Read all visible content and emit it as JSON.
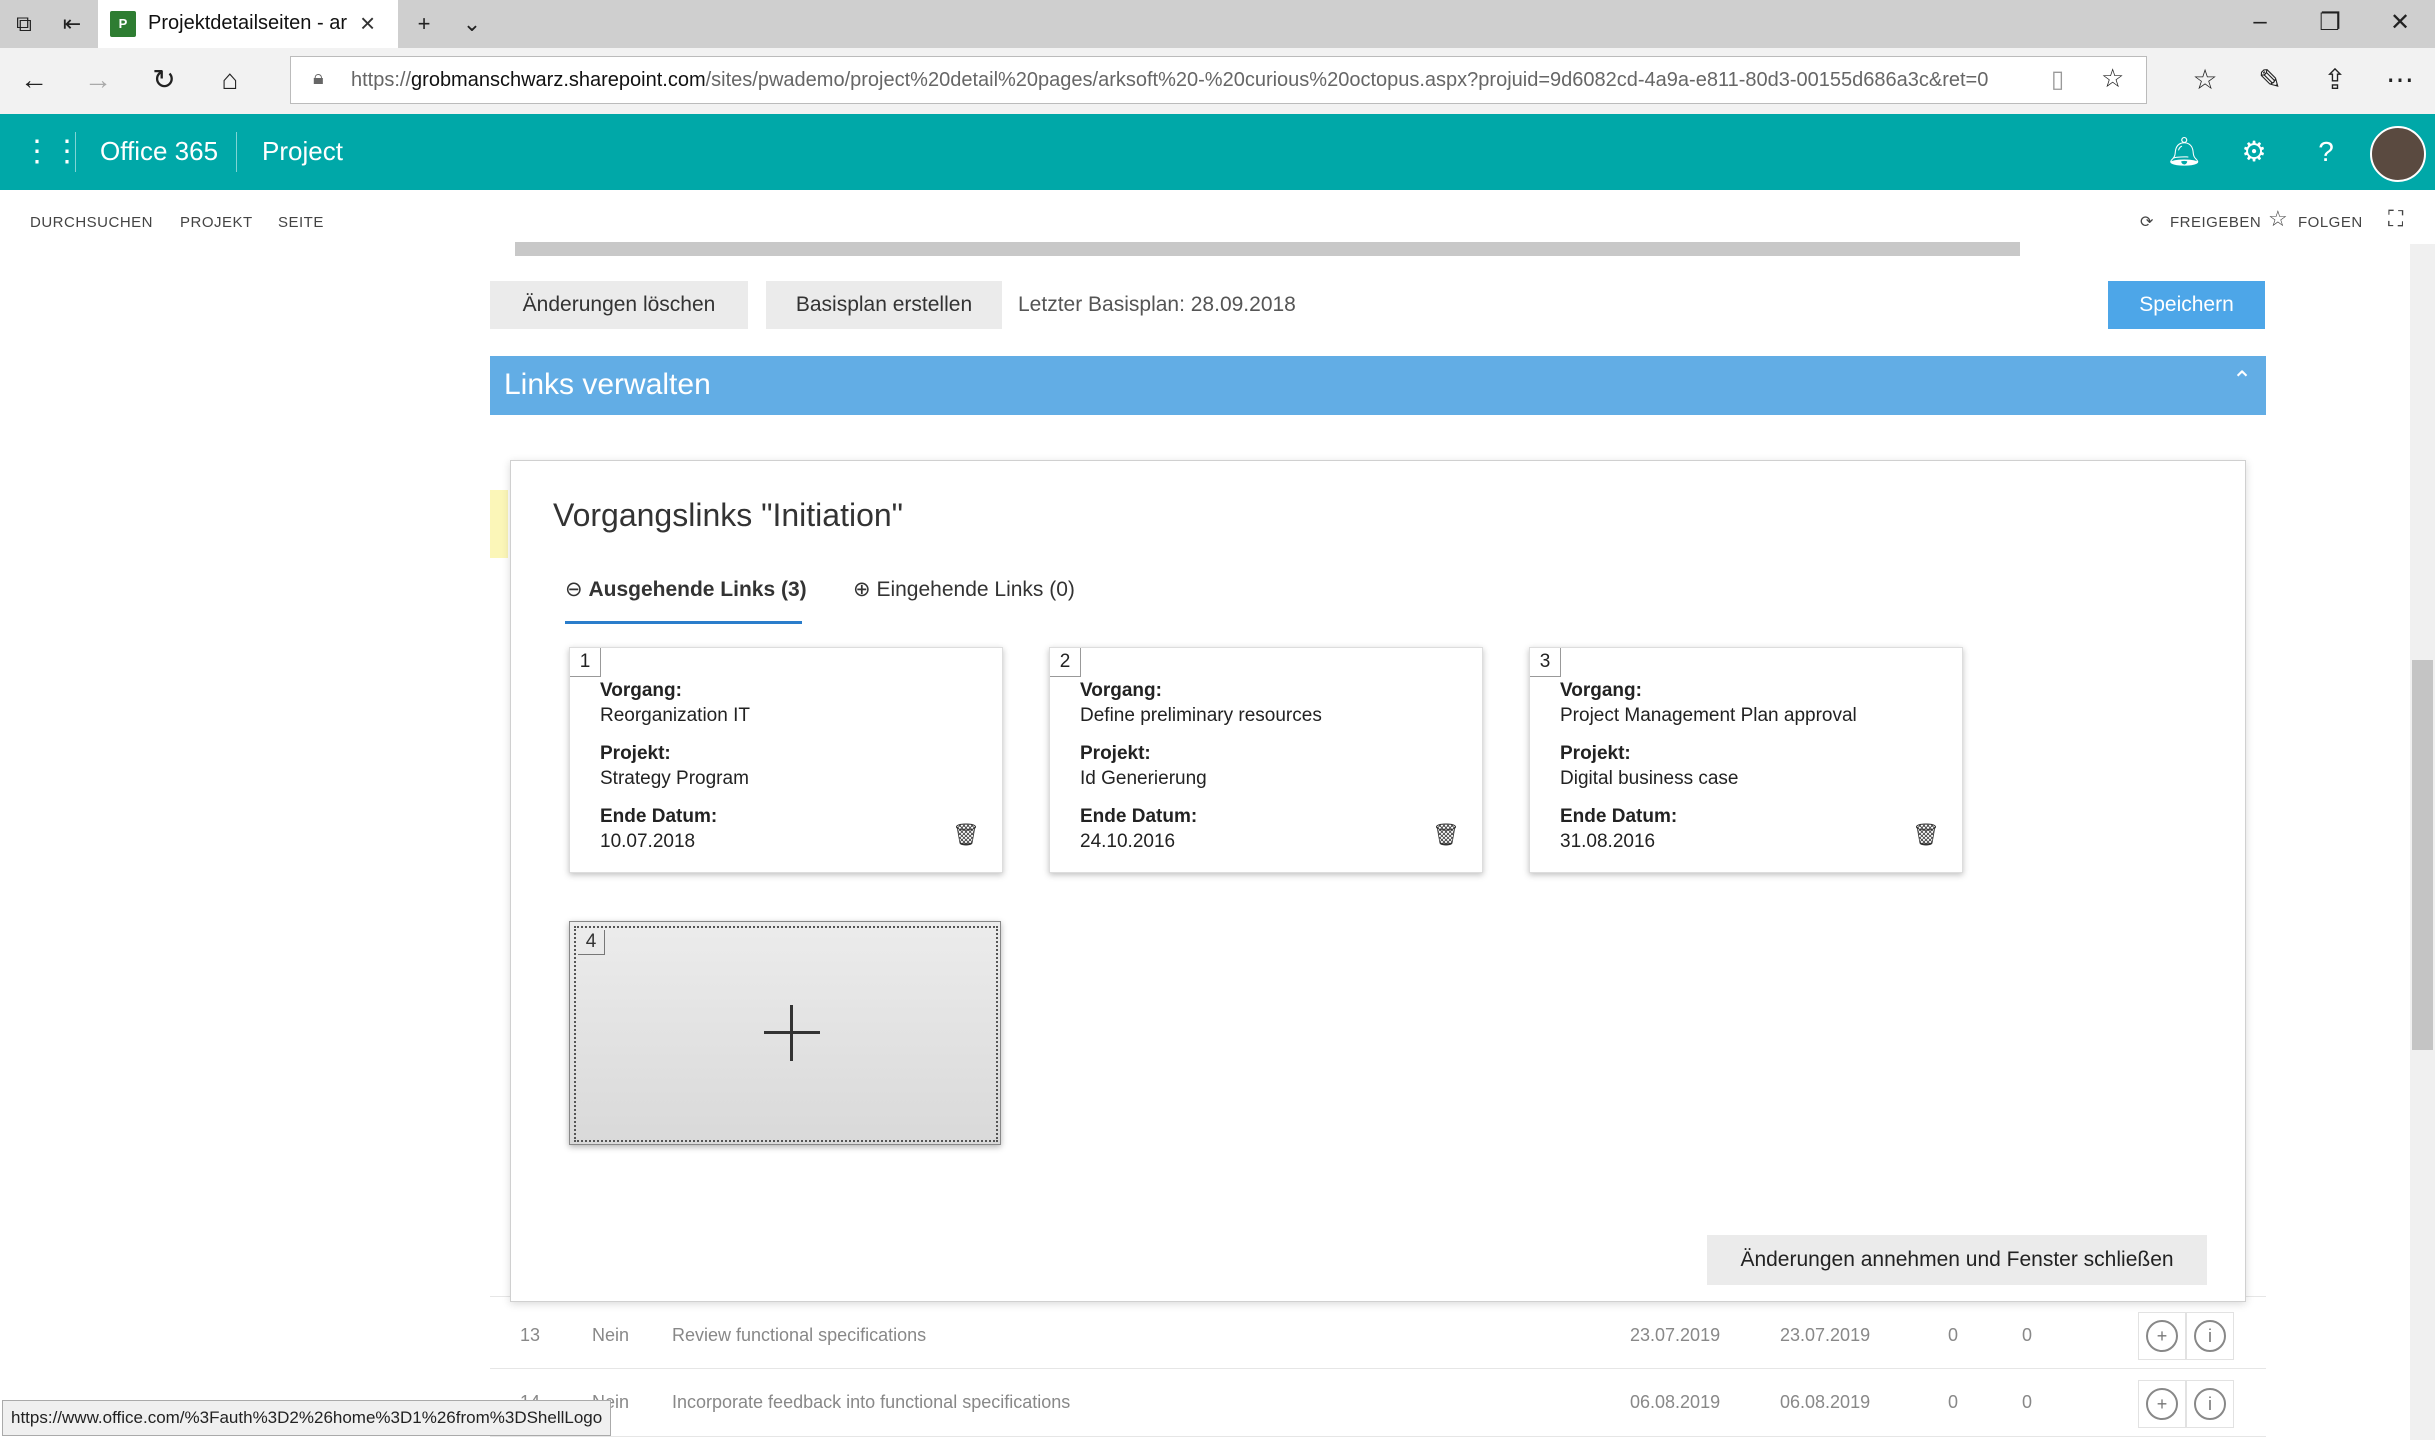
{
  "browser": {
    "tab_title": "Projektdetailseiten - ark",
    "tab_favicon": "P",
    "url_prefix": "https://",
    "url_host": "grobmanschwarz.sharepoint.com",
    "url_path": "/sites/pwademo/project%20detail%20pages/arksoft%20-%20curious%20octopus.aspx?projuid=9d6082cd-4a9a-e811-80d3-00155d686a3c&ret=0"
  },
  "o365": {
    "app_name": "Office 365",
    "product": "Project"
  },
  "ribbon": {
    "items": [
      "DURCHSUCHEN",
      "PROJEKT",
      "SEITE"
    ],
    "share": "FREIGEBEN",
    "follow": "FOLGEN"
  },
  "toolbar": {
    "discard_label": "Änderungen löschen",
    "baseline_label": "Basisplan erstellen",
    "last_baseline": "Letzter Basisplan: 28.09.2018",
    "save_label": "Speichern"
  },
  "section": {
    "title": "Links verwalten"
  },
  "modal": {
    "title": "Vorgangslinks \"Initiation\"",
    "tab_outgoing": "Ausgehende Links (3)",
    "tab_incoming": "Eingehende Links (0)",
    "labels": {
      "task": "Vorgang:",
      "project": "Projekt:",
      "end_date": "Ende Datum:"
    },
    "cards": [
      {
        "num": "1",
        "task": "Reorganization IT",
        "project": "Strategy Program",
        "end": "10.07.2018"
      },
      {
        "num": "2",
        "task": "Define preliminary resources",
        "project": "Id Generierung",
        "end": "24.10.2016"
      },
      {
        "num": "3",
        "task": "Project Management Plan approval",
        "project": "Digital business case",
        "end": "31.08.2016"
      }
    ],
    "add_card_num": "4",
    "accept_label": "Änderungen annehmen und Fenster schließen"
  },
  "rows": [
    {
      "id": "13",
      "flag": "Nein",
      "name": "Review functional specifications",
      "start": "23.07.2019",
      "end": "23.07.2019",
      "a": "0",
      "b": "0"
    },
    {
      "id": "14",
      "flag": "Nein",
      "name": "Incorporate feedback into functional specifications",
      "start": "06.08.2019",
      "end": "06.08.2019",
      "a": "0",
      "b": "0"
    }
  ],
  "statusbar": {
    "url": "https://www.office.com/%3Fauth%3D2%26home%3D1%26from%3DShellLogo"
  },
  "colors": {
    "o365_header": "#00a8a8",
    "section_bar": "#62ade5",
    "save_button": "#4da6e8",
    "tab_underline": "#2a7dcb"
  }
}
